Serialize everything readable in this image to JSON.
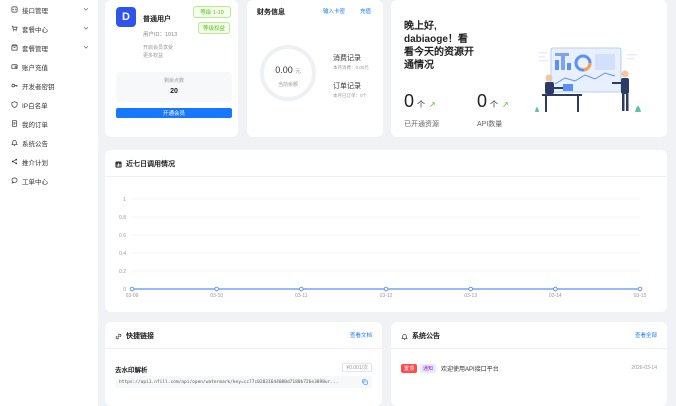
{
  "sidebar": {
    "items": [
      {
        "label": "接口管理",
        "icon": "api-icon",
        "has_children": true
      },
      {
        "label": "套餐中心",
        "icon": "cart-icon",
        "has_children": true
      },
      {
        "label": "套餐管理",
        "icon": "box-icon",
        "has_children": true
      },
      {
        "label": "账户充值",
        "icon": "wallet-icon",
        "has_children": false
      },
      {
        "label": "开发者密钥",
        "icon": "key-icon",
        "has_children": false
      },
      {
        "label": "IP白名单",
        "icon": "shield-icon",
        "has_children": false
      },
      {
        "label": "我的订单",
        "icon": "order-icon",
        "has_children": false
      },
      {
        "label": "系统公告",
        "icon": "bell-icon",
        "has_children": false
      },
      {
        "label": "推介计划",
        "icon": "share-icon",
        "has_children": false
      },
      {
        "label": "工单中心",
        "icon": "chat-icon",
        "has_children": false
      }
    ]
  },
  "user": {
    "avatar_letter": "D",
    "name": "普通用户",
    "level_badge": "等级 1-10",
    "level_link": "等级权益",
    "uid": "用户ID：1013",
    "desc_line1": "开启会员享受",
    "desc_line2": "更多权益",
    "balance_label": "剩余点数",
    "balance_value": "20",
    "open_button": "开通会员"
  },
  "finance": {
    "title": "财务信息",
    "link_invite": "输入卡密",
    "link_recharge": "充值",
    "amount": "0.00",
    "amount_unit": "元",
    "amount_label": "当前余额",
    "consume_title": "消费记录",
    "consume_sub": "本月消费：0.00元",
    "order_title": "订单记录",
    "order_sub": "本月已订单：0个"
  },
  "welcome": {
    "greeting_line1": "晚上好,",
    "greeting_line2": "dabiaoge！看",
    "greeting_line3": "看今天的资源开",
    "greeting_line4": "通情况",
    "resources_count": "0",
    "resources_unit": "个",
    "resources_label": "已开通资源",
    "api_count": "0",
    "api_unit": "个",
    "api_label": "API数量",
    "trend_arrow": "↗"
  },
  "usage_chart": {
    "title": "近七日调用情况"
  },
  "chart_data": {
    "type": "line",
    "title": "近七日调用情况",
    "xlabel": "",
    "ylabel": "",
    "categories": [
      "03-09",
      "03-10",
      "03-11",
      "03-12",
      "03-13",
      "03-14",
      "03-15"
    ],
    "series": [
      {
        "values": [
          0,
          0,
          0,
          0,
          0,
          0,
          0
        ]
      }
    ],
    "y_ticks": [
      "0",
      "0.2",
      "0.4",
      "0.6",
      "0.8",
      "1"
    ],
    "ylim": [
      0,
      1
    ],
    "grid": true,
    "color": "#5b8ff9"
  },
  "quick_links": {
    "title": "快捷链接",
    "more_link": "查看文档",
    "api_name": "去水印解析",
    "api_price": "¥0.001/次",
    "api_url": "https://api1.nfill.com/api/open/watermark/key=cc77c02031644080d7180b726e3898ur..."
  },
  "notices": {
    "title": "系统公告",
    "more_link": "查看全部",
    "items": [
      {
        "tag1": "置顶",
        "tag2": "通知",
        "text": "欢迎使用API接口平台",
        "date": "2026-03-14"
      }
    ]
  },
  "colors": {
    "primary": "#1677ff",
    "avatar": "#2f54eb",
    "success": "#52c41a",
    "chart_line": "#5b8ff9",
    "tag_hot": "#ff4d4f"
  }
}
